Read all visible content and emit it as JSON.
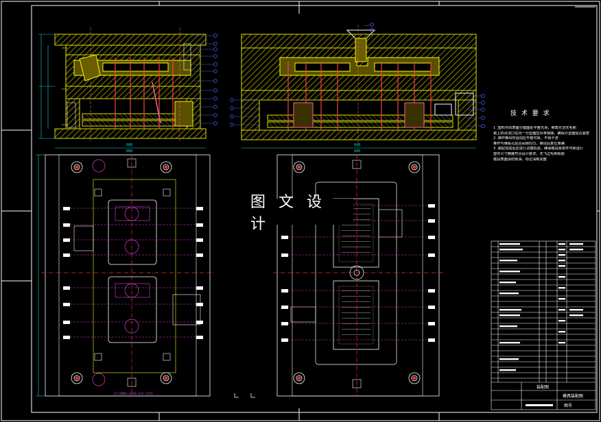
{
  "drawing": {
    "watermark": "图 文 设 计",
    "technical_requirements": {
      "title": "技 术 要 求",
      "notes": [
        "1 .塑料件的表面分模面处平整光滑，倒角光洁无毛刺",
        "装上的点浇口在同一分型面应对准相接，确保分型面贴合紧密",
        "2 .推杆推出时运动应平稳可靠，不得卡滞",
        "推杆与推板孔配合间隙均匀，推出后复位准确",
        "3 .装配完成后应进行试模检验，确保模具各部件可靠运行",
        "塑件尺寸精度符合设计要求，无飞边毛刺缺陷",
        "模具表面涂防锈油，标记清晰完整"
      ]
    },
    "side_view_dims": {
      "left_width": "600",
      "right_width": "600"
    },
    "top_view_dims": {
      "left_width": "600",
      "right_width": "600"
    },
    "bottom_caption": "CI-BQRV-2016/3/6-C215",
    "title_block": {
      "drawing_name": "模具装配图",
      "label_a": "装配图",
      "label_b": "图号"
    },
    "colors": {
      "background": "#000000",
      "frame": "#ffffff",
      "outline": "#e0e000",
      "hatch": "#b8b800",
      "part": "#ff4040",
      "centerline": "#ff0000",
      "dimension": "#00e0e0",
      "leader": "#5060ff",
      "text": "#ffffff",
      "magenta": "#e040e0",
      "pink": "#ff60a0"
    }
  }
}
